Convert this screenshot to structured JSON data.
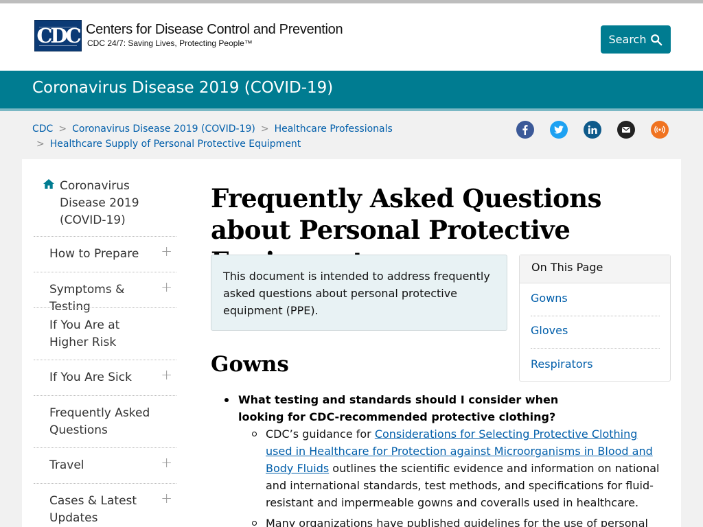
{
  "header": {
    "logo_text": "CDC",
    "org_name": "Centers for Disease Control and Prevention",
    "tagline": "CDC 24/7: Saving Lives, Protecting People™",
    "search_label": "Search"
  },
  "site_title": "Coronavirus Disease 2019 (COVID-19)",
  "breadcrumb": {
    "items": [
      "CDC",
      "Coronavirus Disease 2019 (COVID-19)",
      "Healthcare Professionals",
      "Healthcare Supply of Personal Protective Equipment"
    ],
    "separator": ">"
  },
  "social": {
    "icons": [
      "facebook-icon",
      "twitter-icon",
      "linkedin-icon",
      "email-icon",
      "syndicate-icon"
    ],
    "colors": {
      "facebook": "#3b5998",
      "twitter": "#1da1f2",
      "linkedin": "#0e5a8a",
      "email": "#222222",
      "syndicate": "#f07320"
    }
  },
  "sidebar": {
    "home_title": "Coronavirus Disease 2019 (COVID-19)",
    "items": [
      {
        "label": "How to Prepare",
        "expandable": true
      },
      {
        "label": "Symptoms & Testing",
        "expandable": true
      },
      {
        "label": "If You Are at Higher Risk",
        "expandable": false
      },
      {
        "label": "If You Are Sick",
        "expandable": true
      },
      {
        "label": "Frequently Asked Questions",
        "expandable": false
      },
      {
        "label": "Travel",
        "expandable": true
      },
      {
        "label": "Cases & Latest Updates",
        "expandable": true
      }
    ],
    "expand_glyph": "+"
  },
  "main": {
    "title": "Frequently Asked Questions about Personal Protective Equipment",
    "intro": "This document is intended to address frequently asked questions about personal protective equipment (PPE).",
    "section_heading": "Gowns",
    "question": "What testing and standards should I consider when looking for CDC-recommended protective clothing?",
    "answer_prefix": "CDC’s guidance for ",
    "answer_link": "Considerations for Selecting Protective Clothing used in Healthcare for Protection against Microorganisms in Blood and Body Fluids",
    "answer_suffix": " outlines the scientific evidence and information on national and international standards, test methods, and specifications for fluid-resistant and impermeable gowns and coveralls used in healthcare.",
    "answer2_partial": "Many organizations have published guidelines for the use of personal"
  },
  "on_this_page": {
    "heading": "On This Page",
    "links": [
      "Gowns",
      "Gloves",
      "Respirators"
    ]
  },
  "colors": {
    "brand_teal": "#007c91",
    "link": "#005eaa",
    "cdc_blue": "#0b3a75",
    "intro_bg": "#e8f2f4"
  }
}
